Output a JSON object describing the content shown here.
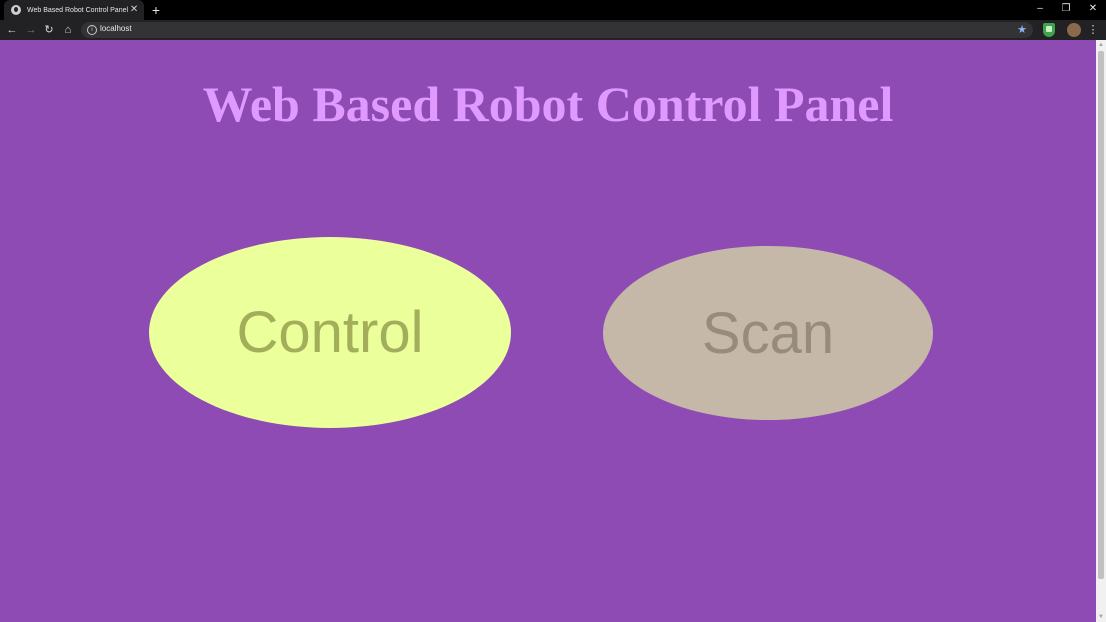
{
  "browser": {
    "tab": {
      "title": "Web Based Robot Control Panel",
      "close_glyph": "✕",
      "favicon": "globe-icon"
    },
    "new_tab_glyph": "+",
    "window_controls": {
      "minimize": "–",
      "restore": "❐",
      "close": "✕"
    },
    "nav": {
      "back": "←",
      "forward": "→",
      "reload": "↻",
      "home": "⌂"
    },
    "omnibox": {
      "url": "localhost",
      "info_glyph": "i",
      "star_glyph": "★"
    },
    "menu_glyph": "⋮"
  },
  "page": {
    "title": "Web Based Robot Control Panel",
    "buttons": {
      "control_label": "Control",
      "scan_label": "Scan"
    }
  },
  "colors": {
    "page_background": "#8e4bb4",
    "title": "#df99ff",
    "control_fill": "#ebff9b",
    "control_text": "#a3ae5b",
    "scan_fill": "#c6b8a8",
    "scan_text": "#978b7e"
  },
  "scrollbar": {
    "up_glyph": "▲",
    "down_glyph": "▼"
  }
}
